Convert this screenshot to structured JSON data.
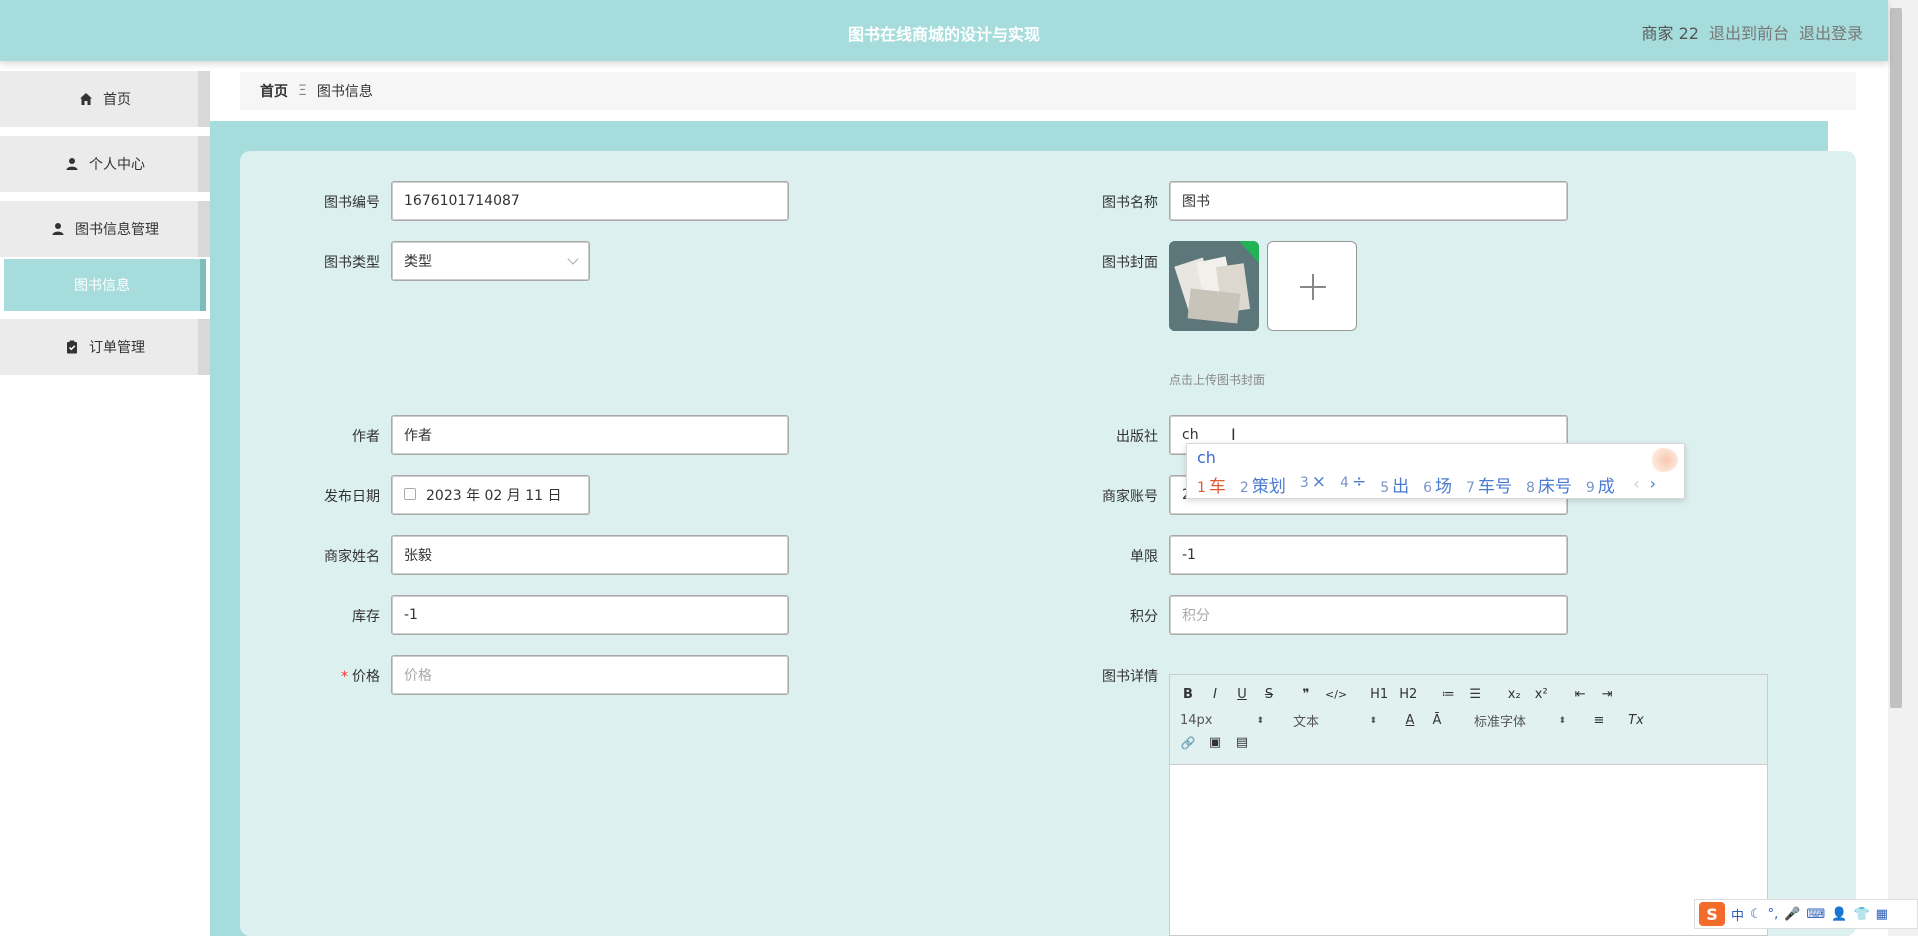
{
  "header": {
    "title": "图书在线商城的设计与实现",
    "user": "商家 22",
    "to_front": "退出到前台",
    "logout": "退出登录"
  },
  "sidebar": {
    "items": [
      {
        "label": "首页",
        "icon": "home-icon"
      },
      {
        "label": "个人中心",
        "icon": "user-icon"
      },
      {
        "label": "图书信息管理",
        "icon": "user-icon"
      },
      {
        "label": "订单管理",
        "icon": "clipboard-icon"
      }
    ],
    "submenu_active": "图书信息"
  },
  "breadcrumb": {
    "home": "首页",
    "separator": "Ξ",
    "current": "图书信息"
  },
  "form": {
    "book_no": {
      "label": "图书编号",
      "value": "1676101714087"
    },
    "book_name": {
      "label": "图书名称",
      "value": "图书"
    },
    "book_type": {
      "label": "图书类型",
      "value": "类型"
    },
    "cover": {
      "label": "图书封面",
      "hint": "点击上传图书封面"
    },
    "author": {
      "label": "作者",
      "value": "作者"
    },
    "publisher": {
      "label": "出版社",
      "value": "ch"
    },
    "publish_date": {
      "label": "发布日期",
      "value": "2023 年 02 月 11 日"
    },
    "merchant_account": {
      "label": "商家账号",
      "value": "22"
    },
    "merchant_name": {
      "label": "商家姓名",
      "value": "张毅"
    },
    "limit": {
      "label": "单限",
      "value": "-1"
    },
    "stock": {
      "label": "库存",
      "value": "-1"
    },
    "points": {
      "label": "积分",
      "placeholder": "积分"
    },
    "price": {
      "label": "价格",
      "required_mark": "*",
      "placeholder": "价格"
    },
    "details": {
      "label": "图书详情"
    }
  },
  "ime_popup": {
    "input": "ch",
    "candidates": [
      {
        "n": "1",
        "text": "车"
      },
      {
        "n": "2",
        "text": "策划"
      },
      {
        "n": "3",
        "text": "×"
      },
      {
        "n": "4",
        "text": "÷"
      },
      {
        "n": "5",
        "text": "出"
      },
      {
        "n": "6",
        "text": "场"
      },
      {
        "n": "7",
        "text": "车号"
      },
      {
        "n": "8",
        "text": "床号"
      },
      {
        "n": "9",
        "text": "成"
      }
    ],
    "prev": "‹",
    "next": "›"
  },
  "editor": {
    "row1": [
      "B",
      "I",
      "U",
      "S",
      "❞",
      "</>",
      "H1",
      "H2",
      "≔",
      "☰",
      "x₂",
      "x²",
      "⇤",
      "⇥"
    ],
    "font_size": "14px",
    "block_type": "文本",
    "font_family": "标准字体",
    "select_arrow": "⬍",
    "color_btn": "A",
    "bg_btn": "Ā",
    "align_btn": "≡",
    "clear_btn": "Tx",
    "row3": [
      "🔗",
      "▣",
      "▤"
    ]
  },
  "ime_bar": {
    "logo": "S",
    "mode": "中",
    "items": [
      "☾",
      "°,",
      "🎤",
      "⌨",
      "👤",
      "👕",
      "▦"
    ]
  }
}
